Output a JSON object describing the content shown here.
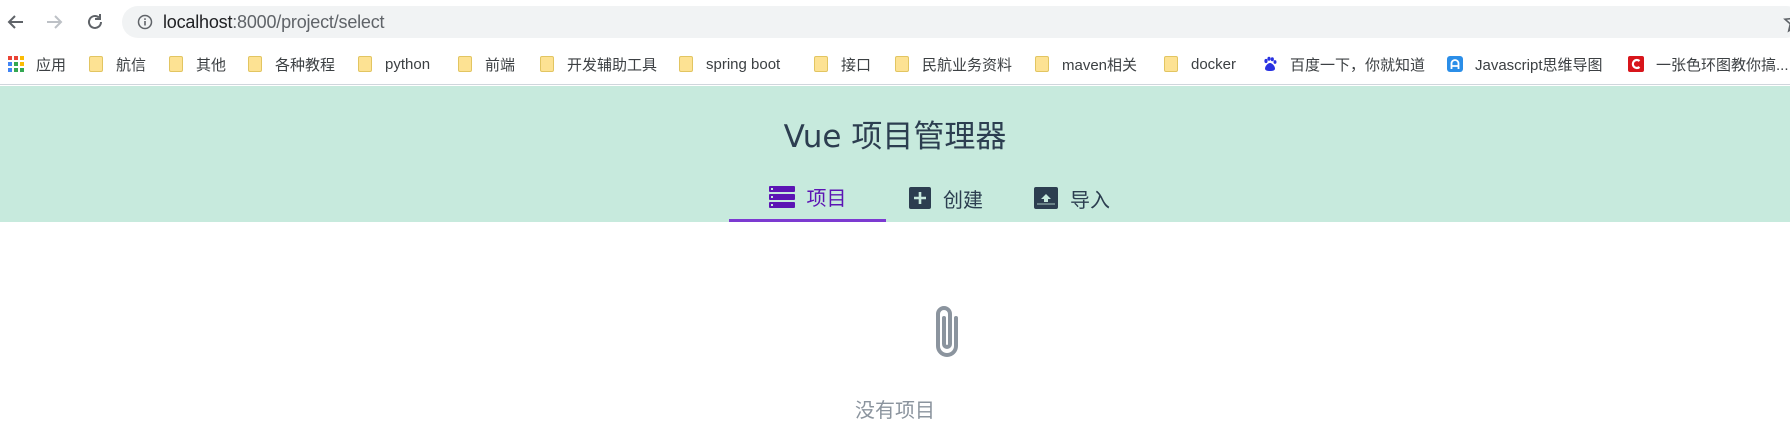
{
  "browser": {
    "url_host": "localhost",
    "url_path": ":8000/project/select",
    "icons": {
      "back": "arrow-left-icon",
      "forward": "arrow-right-icon",
      "reload": "reload-icon",
      "info": "info-icon",
      "star": "star-icon"
    }
  },
  "bookmarks": [
    {
      "label": "应用",
      "icon": "apps-grid-icon"
    },
    {
      "label": "航信",
      "icon": "folder-icon"
    },
    {
      "label": "其他",
      "icon": "folder-icon"
    },
    {
      "label": "各种教程",
      "icon": "folder-icon"
    },
    {
      "label": "python",
      "icon": "folder-icon"
    },
    {
      "label": "前端",
      "icon": "folder-icon"
    },
    {
      "label": "开发辅助工具",
      "icon": "folder-icon"
    },
    {
      "label": "spring boot",
      "icon": "folder-icon"
    },
    {
      "label": "接口",
      "icon": "folder-icon"
    },
    {
      "label": "民航业务资料",
      "icon": "folder-icon"
    },
    {
      "label": "maven相关",
      "icon": "folder-icon"
    },
    {
      "label": "docker",
      "icon": "folder-icon"
    },
    {
      "label": "百度一下，你就知道",
      "icon": "baidu-paw-icon"
    },
    {
      "label": "Javascript思维导图",
      "icon": "site-a-icon"
    },
    {
      "label": "一张色环图教你搞...",
      "icon": "site-c-icon"
    }
  ],
  "app": {
    "title": "Vue 项目管理器",
    "tabs": [
      {
        "label": "项目",
        "icon": "list-icon",
        "active": true
      },
      {
        "label": "创建",
        "icon": "add-box-icon",
        "active": false
      },
      {
        "label": "导入",
        "icon": "upload-box-icon",
        "active": false
      }
    ],
    "empty_text": "没有项目",
    "empty_icon": "paperclip-icon"
  },
  "colors": {
    "header_bg": "#c7eadd",
    "title": "#2c3e50",
    "active_tab": "#5c14b4",
    "active_underline": "#7c3ad1",
    "empty_text": "#8b949e"
  }
}
